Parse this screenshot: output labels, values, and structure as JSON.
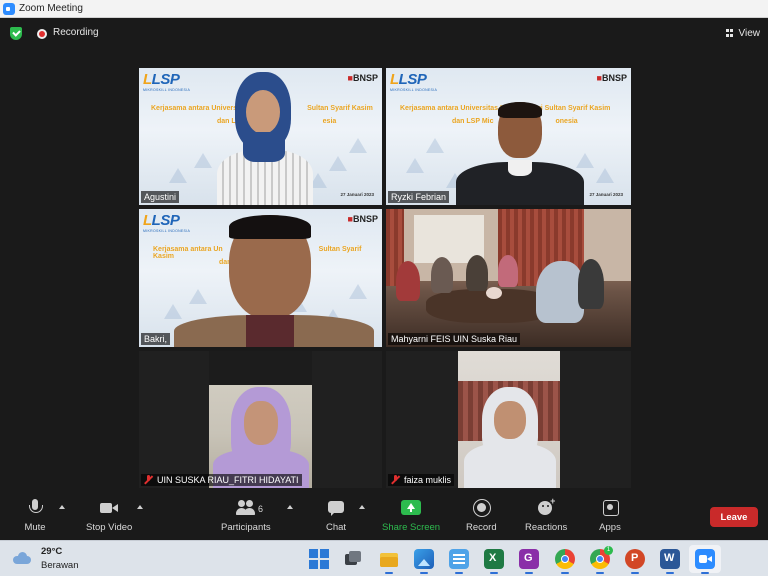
{
  "window": {
    "title": "Zoom Meeting"
  },
  "topbar": {
    "recording_label": "Recording",
    "view_label": "View"
  },
  "tiles": [
    {
      "name": "Agustini",
      "muted": false
    },
    {
      "name": "Ryzki Febrian",
      "muted": false,
      "active_speaker": true
    },
    {
      "name": "Bakri,",
      "muted": false
    },
    {
      "name": "Mahyarni FEIS UIN Suska Riau",
      "muted": false
    },
    {
      "name": "UIN SUSKA RIAU_FITRI HIDAYATI",
      "muted": true
    },
    {
      "name": "faiza muklis",
      "muted": true
    }
  ],
  "banner": {
    "logo_left": "LSP",
    "logo_left_sub": "MIKROSKILL INDONESIA",
    "logo_right": "BNSP",
    "line1_full": "Kerjasama antara Universitas Islam Negeri Sultan Syarif Kasim",
    "line2_full": "dan LSP Mikroskill Indonesia",
    "tile1_line1": "Kerjasama antara Universitas",
    "tile1_line1b": "Sultan Syarif Kasim",
    "tile1_line2": "dan LSP M",
    "tile1_line2b": "esia",
    "tile2_line1": "Kerjasama antara Universitas I",
    "tile2_line1b": "egeri Sultan Syarif Kasim",
    "tile2_line2": "dan LSP Mic",
    "tile2_line2b": "onesia",
    "tile3_line1": "Kerjasama antara Un",
    "tile3_line1b": "Sultan Syarif Kasim",
    "tile3_line2": "dan LSI",
    "date": "27 Januari 2023"
  },
  "toolbar": {
    "mute": "Mute",
    "stop_video": "Stop Video",
    "participants": "Participants",
    "participants_count": "6",
    "chat": "Chat",
    "share_screen": "Share Screen",
    "record": "Record",
    "reactions": "Reactions",
    "apps": "Apps",
    "leave": "Leave"
  },
  "taskbar": {
    "temperature": "29°C",
    "condition": "Berawan",
    "apps": [
      "windows-start",
      "task-view",
      "file-explorer",
      "photos",
      "notepad",
      "excel",
      "gamma",
      "chrome",
      "chrome-profile",
      "powerpoint",
      "word",
      "zoom"
    ],
    "chrome_profile_badge": "1"
  },
  "colors": {
    "share_green": "#2dbb4e",
    "leave_red": "#c92a2a",
    "active_speaker_border": "#d6e64a",
    "banner_orange": "#e8a422",
    "lsp_blue": "#1f65b8"
  }
}
